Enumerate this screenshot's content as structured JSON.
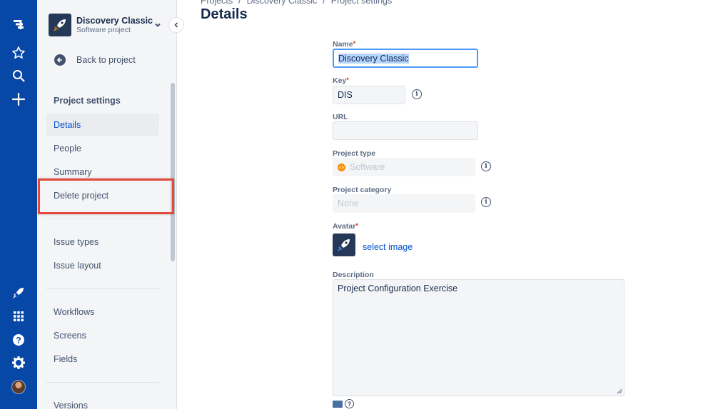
{
  "breadcrumbs": [
    "Projects",
    "Discovery Classic",
    "Project settings"
  ],
  "page_title": "Details",
  "project": {
    "name": "Discovery Classic",
    "type": "Software project"
  },
  "sidebar": {
    "back_label": "Back to project",
    "section_title": "Project settings",
    "items": [
      {
        "label": "Details",
        "active": true
      },
      {
        "label": "People"
      },
      {
        "label": "Summary"
      },
      {
        "label": "Delete project"
      },
      {
        "label": "Issue types"
      },
      {
        "label": "Issue layout"
      },
      {
        "label": "Workflows"
      },
      {
        "label": "Screens"
      },
      {
        "label": "Fields"
      },
      {
        "label": "Versions"
      }
    ]
  },
  "form": {
    "name_label": "Name",
    "name_value": "Discovery Classic",
    "key_label": "Key",
    "key_value": "DIS",
    "url_label": "URL",
    "url_value": "",
    "project_type_label": "Project type",
    "project_type_value": "Software",
    "project_category_label": "Project category",
    "project_category_value": "None",
    "avatar_label": "Avatar",
    "select_image_label": "select image",
    "description_label": "Description",
    "description_value": "Project Configuration Exercise",
    "required_mark": "*"
  },
  "icons": {
    "global_nav": [
      "jira-logo-icon",
      "star-icon",
      "search-icon",
      "plus-icon",
      "rocket-icon",
      "apps-grid-icon",
      "help-icon",
      "gear-icon",
      "avatar"
    ],
    "info_icon_text": "i",
    "help_icon_text": "?"
  },
  "colors": {
    "global_nav": "#0747a6",
    "accent": "#0052cc",
    "highlight_box": "#e5493a",
    "required": "#de350b"
  }
}
